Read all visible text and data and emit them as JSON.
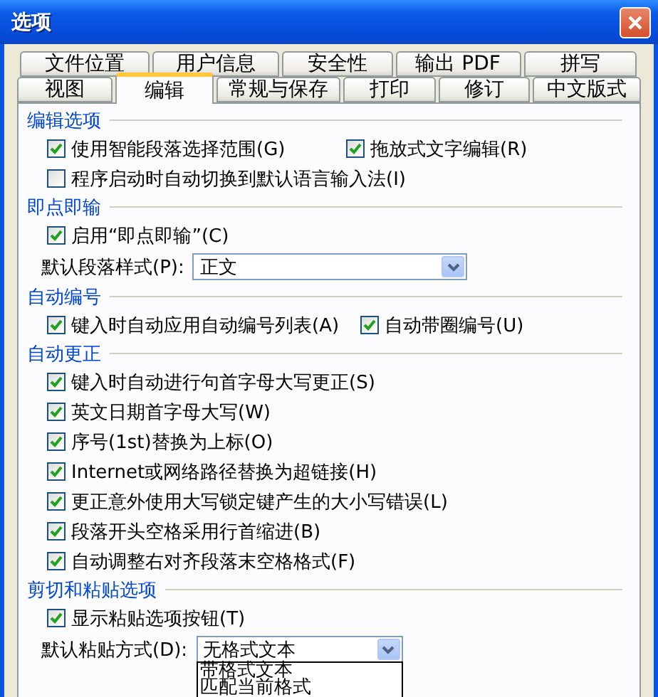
{
  "window": {
    "title": "选项"
  },
  "tab_rows": [
    [
      {
        "label": "文件位置",
        "selected": false
      },
      {
        "label": "用户信息",
        "selected": false
      },
      {
        "label": "安全性",
        "selected": false
      },
      {
        "label": "输出 PDF",
        "selected": false
      },
      {
        "label": "拼写",
        "selected": false
      }
    ],
    [
      {
        "label": "视图",
        "selected": false
      },
      {
        "label": "编辑",
        "selected": true
      },
      {
        "label": "常规与保存",
        "selected": false
      },
      {
        "label": "打印",
        "selected": false
      },
      {
        "label": "修订",
        "selected": false
      },
      {
        "label": "中文版式",
        "selected": false
      }
    ]
  ],
  "sections": [
    {
      "title": "编辑选项",
      "items": [
        {
          "kind": "checks",
          "checks": [
            {
              "label": "使用智能段落选择范围(G)",
              "checked": true
            },
            {
              "label": "拖放式文字编辑(R)",
              "checked": true
            }
          ]
        },
        {
          "kind": "checks",
          "checks": [
            {
              "label": "程序启动时自动切换到默认语言输入法(I)",
              "checked": false
            }
          ]
        }
      ]
    },
    {
      "title": "即点即输",
      "items": [
        {
          "kind": "checks",
          "checks": [
            {
              "label": "启用“即点即输”(C)",
              "checked": true
            }
          ]
        },
        {
          "kind": "select",
          "label": "默认段落样式(P):",
          "value": "正文",
          "expanded": false
        }
      ]
    },
    {
      "title": "自动编号",
      "items": [
        {
          "kind": "checks",
          "checks": [
            {
              "label": "键入时自动应用自动编号列表(A)",
              "checked": true
            },
            {
              "label": "自动带圈编号(U)",
              "checked": true
            }
          ]
        }
      ]
    },
    {
      "title": "自动更正",
      "items": [
        {
          "kind": "checks",
          "checks": [
            {
              "label": "键入时自动进行句首字母大写更正(S)",
              "checked": true
            }
          ]
        },
        {
          "kind": "checks",
          "checks": [
            {
              "label": "英文日期首字母大写(W)",
              "checked": true
            }
          ]
        },
        {
          "kind": "checks",
          "checks": [
            {
              "label": "序号(1st)替换为上标(O)",
              "checked": true
            }
          ]
        },
        {
          "kind": "checks",
          "checks": [
            {
              "label": "Internet或网络路径替换为超链接(H)",
              "checked": true
            }
          ]
        },
        {
          "kind": "checks",
          "checks": [
            {
              "label": "更正意外使用大写锁定键产生的大小写错误(L)",
              "checked": true
            }
          ]
        },
        {
          "kind": "checks",
          "checks": [
            {
              "label": "段落开头空格采用行首缩进(B)",
              "checked": true
            }
          ]
        },
        {
          "kind": "checks",
          "checks": [
            {
              "label": "自动调整右对齐段落末空格格式(F)",
              "checked": true
            }
          ]
        }
      ]
    },
    {
      "title": "剪切和粘贴选项",
      "items": [
        {
          "kind": "checks",
          "checks": [
            {
              "label": "显示粘贴选项按钮(T)",
              "checked": true
            }
          ]
        },
        {
          "kind": "select",
          "label": "默认粘贴方式(D):",
          "value": "无格式文本",
          "expanded": true,
          "options": [
            "带格式文本",
            "匹配当前格式"
          ]
        }
      ]
    }
  ]
}
